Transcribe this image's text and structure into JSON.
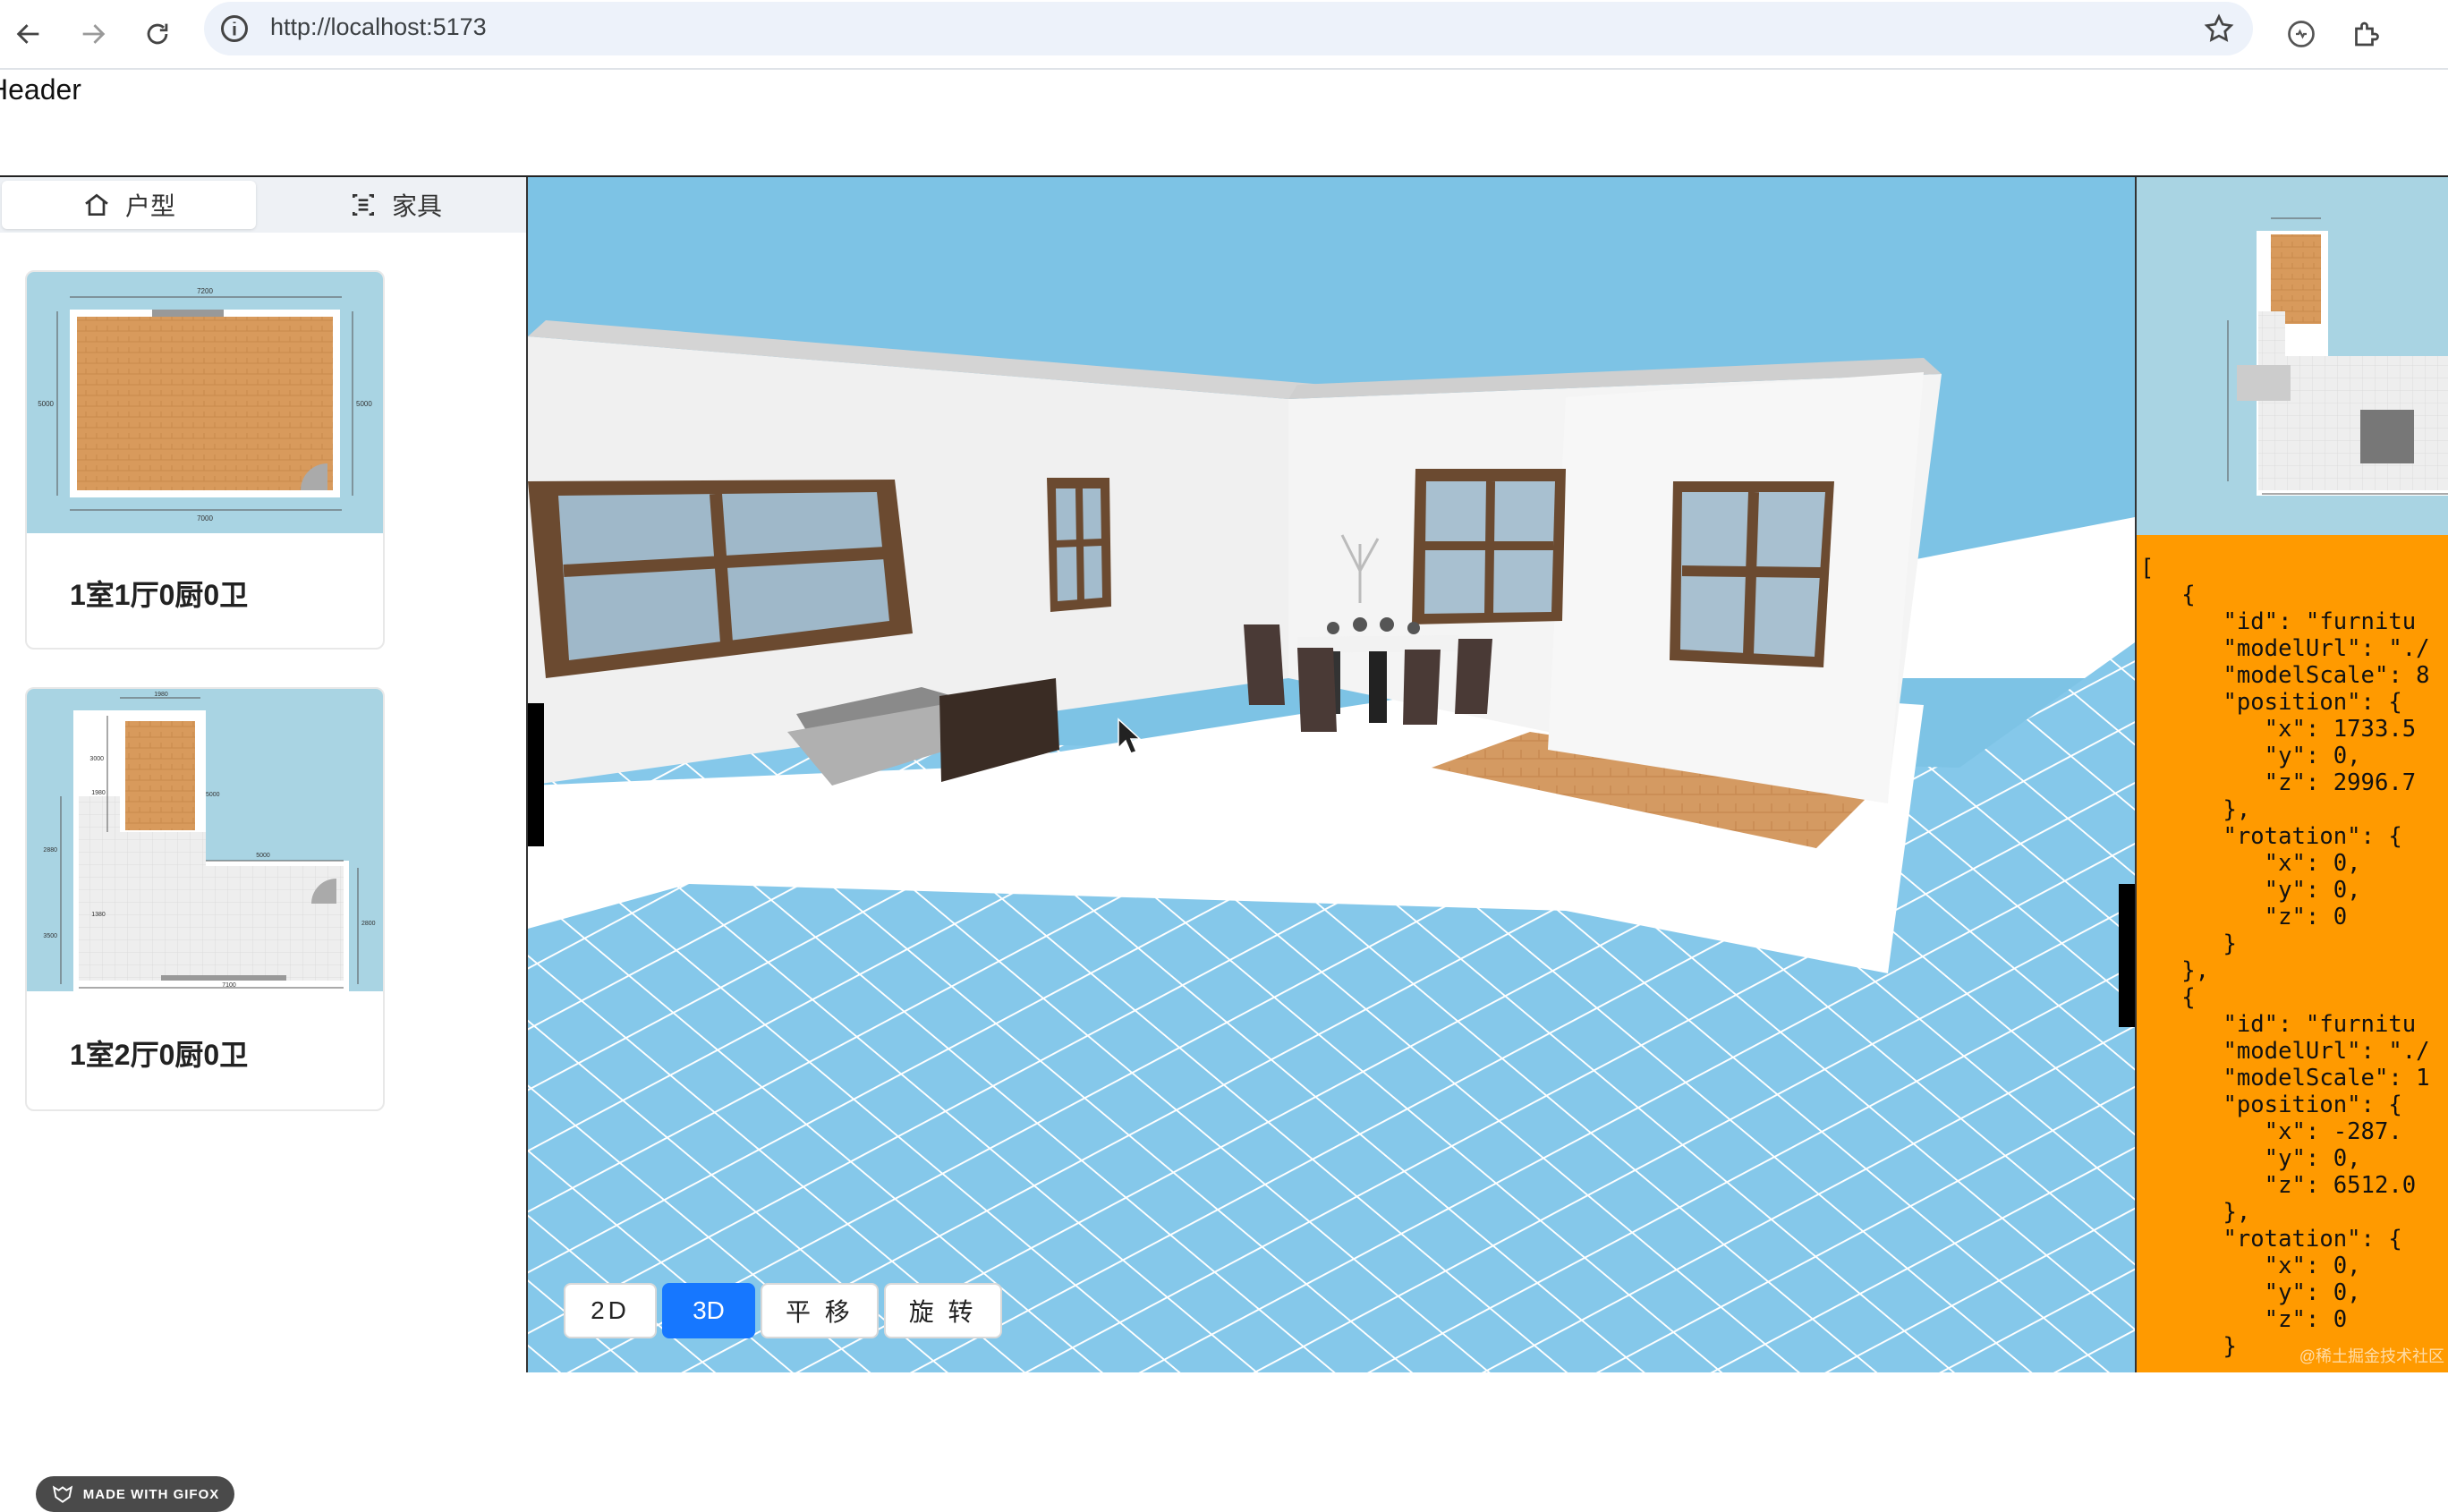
{
  "browser": {
    "url": "http://localhost:5173",
    "icons": [
      "back-arrow-icon",
      "forward-arrow-icon",
      "reload-icon",
      "site-info-icon",
      "bookmark-star-icon",
      "performance-icon",
      "extensions-icon"
    ]
  },
  "header": {
    "text": "Header"
  },
  "sidebar": {
    "tabs": [
      {
        "label": "户型",
        "icon": "home-icon",
        "active": true
      },
      {
        "label": "家具",
        "icon": "furniture-icon",
        "active": false
      }
    ],
    "cards": [
      {
        "title": "1室1厅0厨0卫",
        "plan_labels": [
          "7200",
          "5000",
          "5000",
          "7000"
        ]
      },
      {
        "title": "1室2厅0厨0卫",
        "plan_labels": [
          "1980",
          "3000",
          "5000",
          "1980",
          "2880",
          "5000",
          "2800",
          "1380",
          "3500",
          "7100"
        ]
      }
    ],
    "gifox_label": "MADE WITH GIFOX"
  },
  "viewport": {
    "modes": [
      {
        "label": "2D",
        "active": false
      },
      {
        "label": "3D",
        "active": true
      },
      {
        "label": "平 移",
        "active": false
      },
      {
        "label": "旋 转",
        "active": false
      }
    ]
  },
  "json_panel": {
    "lines": [
      "[",
      "   {",
      "      \"id\": \"furnitu",
      "      \"modelUrl\": \"./",
      "      \"modelScale\": 8",
      "      \"position\": {",
      "         \"x\": 1733.5",
      "         \"y\": 0,",
      "         \"z\": 2996.7",
      "      },",
      "      \"rotation\": {",
      "         \"x\": 0,",
      "         \"y\": 0,",
      "         \"z\": 0",
      "      }",
      "   },",
      "   {",
      "      \"id\": \"furnitu",
      "      \"modelUrl\": \"./",
      "      \"modelScale\": 1",
      "      \"position\": {",
      "         \"x\": -287.",
      "         \"y\": 0,",
      "         \"z\": 6512.0",
      "      },",
      "      \"rotation\": {",
      "         \"x\": 0,",
      "         \"y\": 0,",
      "         \"z\": 0",
      "      }"
    ],
    "watermark": "@稀土掘金技术社区"
  }
}
